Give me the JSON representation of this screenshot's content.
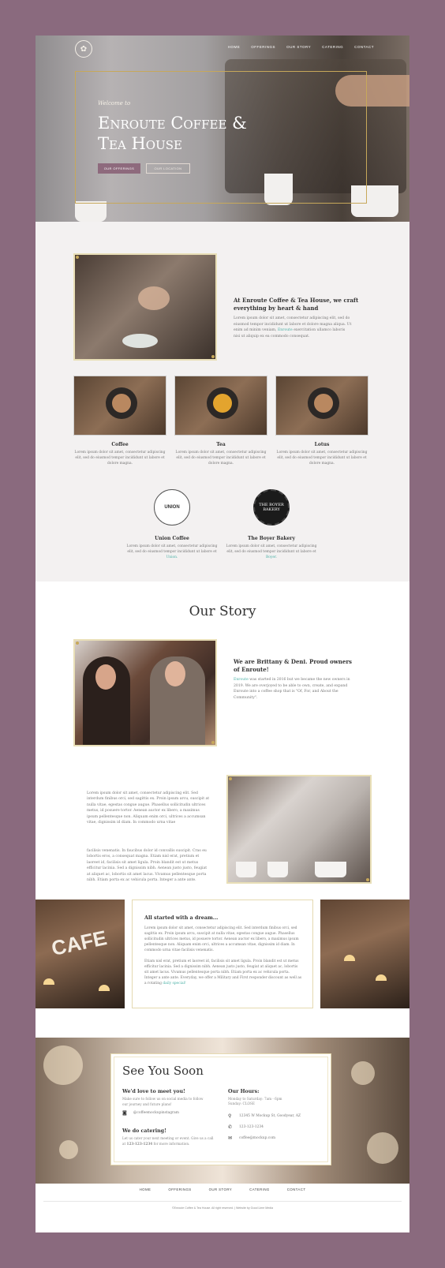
{
  "nav": {
    "items": [
      "HOME",
      "OFFERINGS",
      "OUR STORY",
      "CATERING",
      "CONTACT"
    ]
  },
  "hero": {
    "welcome": "Welcome to",
    "title": "Enroute Coffee & Tea House",
    "primary_button": "OUR OFFERINGS",
    "secondary_button": "OUR LOCATION"
  },
  "intro": {
    "heading": "At Enroute Coffee & Tea House, we craft everything by heart & hand",
    "body_start": "Lorem ipsum dolor sit amet, consectetur adipiscing elit, sed do eiusmod tempor incididunt ut labore et dolore magna aliqua. Ut enim ad minim veniam,",
    "body_link": "Enroute",
    "body_end": "exercitation ullamco laboris nisi ut aliquip ex ea commodo consequat."
  },
  "products": [
    {
      "name": "Coffee",
      "desc": "Lorem ipsum dolor sit amet, consectetur adipiscing elit, sed do eiusmod tempor incididunt ut labore et dolore magna."
    },
    {
      "name": "Tea",
      "desc": "Lorem ipsum dolor sit amet, consectetur adipiscing elit, sed do eiusmod tempor incididunt ut labore et dolore magna."
    },
    {
      "name": "Lotus",
      "desc": "Lorem ipsum dolor sit amet, consectetur adipiscing elit, sed do eiusmod tempor incididunt ut labore et dolore magna."
    }
  ],
  "partners": [
    {
      "logo_text": "UNION",
      "name": "Union Coffee",
      "desc": "Lorem ipsum dolor sit amet, consectetur adipiscing elit, sed do eiusmod tempor incididunt ut labore et",
      "link": "Union."
    },
    {
      "logo_text": "THE BOYER BAKERY",
      "name": "The Boyer Bakery",
      "desc": "Lorem ipsum dolor sit amet, consectetur adipiscing elit, sed do eiusmod tempor incididunt ut labore et",
      "link": "Boyer."
    }
  ],
  "story": {
    "title": "Our Story",
    "heading": "We are Brittany & Deni. Proud owners of Enroute!",
    "body_link": "Enroute",
    "body": "was started in 2016 but we became the new owners in 2019. We are overjoyed to be able to own, create, and expand Enroute into a coffee shop that is \"Of, For, and About the Community\".",
    "para1": "Lorem ipsum dolor sit amet, consectetur adipiscing elit. Sed interdum finibus orci, sed sagittis ex. Proin ipsum arcu, suscipit at nulla vitae, egestas congue augue. Phasellus sollicitudin ultrices metus, id posuere tortor. Aenean auctor ex libero, a maximus ipsum pellentesque non. Aliquam enim orci, ultrices a accumsan vitae, dignissim id diam. In commodo urna vitae",
    "para2": "facilisis venenatis. In faucibus dolor id convallis suscipit. Cras eu lobortis eros, a consequat magna. Etiam nisl erat, pretium et laoreet id, facilisis sit amet ligula. Proin blandit est ut metus efficitur lacinia. Sed a dignissim nibh. Aenean justo justo, feugiat at aliquet ac, lobortis sit amet lacus. Vivamus pellentesque porta nibh. Etiam porta ex ac vehicula porta. Integer a ante ante."
  },
  "dream": {
    "heading": "All started with a dream...",
    "para1": "Lorem ipsum dolor sit amet, consectetur adipiscing elit. Sed interdum finibus orci, sed sagittis ex. Proin ipsum arcu, suscipit at nulla vitae, egestas congue augue. Phasellus sollicitudin ultrices metus, id posuere tortor. Aenean auctor ex libero, a maximus ipsum pellentesque non. Aliquam enim orci, ultrices a accumsan vitae, dignissim id diam. In commodo urna vitae facilisis venenatis.",
    "para2": "Etiam nisl erat, pretium et laoreet id, facilisis sit amet ligula. Proin blandit est ut metus efficitur lacinia. Sed a dignissim nibh. Aenean justo justo, feugiat at aliquet ac, lobortis sit amet lacus. Vivamus pellentesque porta nibh. Etiam porta ex ac vehicula porta. Integer a ante ante. Everyday, we offer a Military and First responder discount as well as a rotating",
    "link": "daily special!",
    "cafe_sign": "CAFE"
  },
  "contact": {
    "title": "See You Soon",
    "meet_heading": "We'd love to meet you!",
    "meet_text": "Make sure to follow us on social media to follow our journey and future plans!",
    "instagram": "@coffeemockupinstagram",
    "catering_heading": "We do catering!",
    "catering_text": "Let us cater your next meeting or event. Give us a call at",
    "catering_phone": "123-123-1234",
    "catering_text_end": "for more information.",
    "hours_heading": "Our Hours:",
    "hours_weekday": "Monday to Saturday: 7am - 6pm",
    "hours_sunday": "Sunday: CLOSE",
    "address": "12345 W Mockup St, Goodyear, AZ",
    "phone": "123-123-1234",
    "email": "coffee@mockup.com"
  },
  "footer": {
    "nav": [
      "HOME",
      "OFFERINGS",
      "OUR STORY",
      "CATERING",
      "CONTACT"
    ],
    "copyright": "©Enroute Coffee & Tea House. All right reserved. | Website by Good Lime Media"
  },
  "colors": {
    "background": "#8a6a7e",
    "accent_gold": "#c7a85a",
    "button_mauve": "#8e6a7d",
    "link_teal": "#4bb1a6"
  }
}
